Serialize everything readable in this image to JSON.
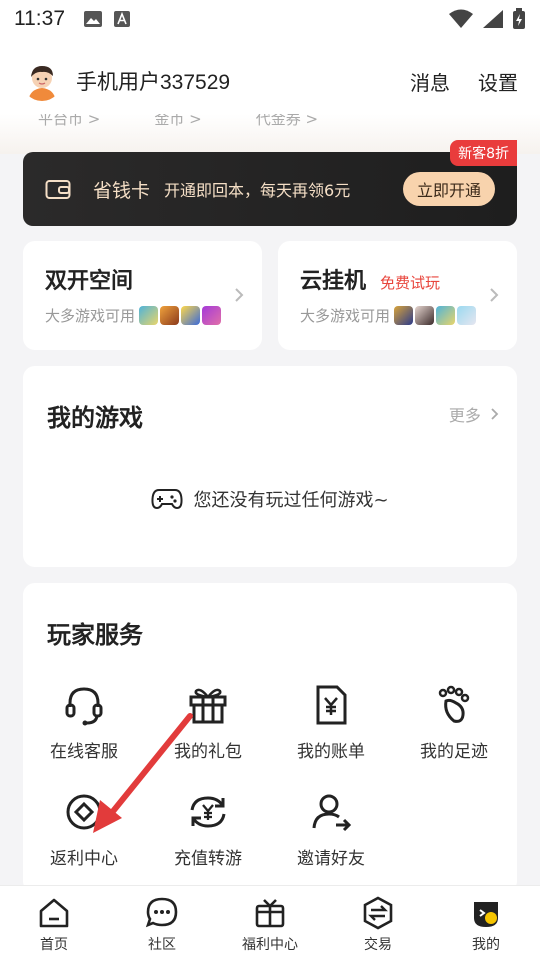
{
  "status_bar": {
    "time": "11:37"
  },
  "header": {
    "username": "手机用户337529",
    "actions": [
      "消息",
      "设置"
    ]
  },
  "cut_row": [
    "平台币 >",
    "金币 >",
    "代金券 >"
  ],
  "vip_card": {
    "title": "省钱卡",
    "description": "开通即回本，每天再领6元",
    "button": "立即开通",
    "badge": "新客8折"
  },
  "dual_space": {
    "title": "双开空间",
    "sub": "大多游戏可用"
  },
  "cloud_hangup": {
    "title": "云挂机",
    "badge": "免费试玩",
    "sub": "大多游戏可用"
  },
  "my_games": {
    "title": "我的游戏",
    "more": "更多",
    "empty_text": "您还没有玩过任何游戏~"
  },
  "services": {
    "title": "玩家服务",
    "items": [
      {
        "label": "在线客服",
        "icon": "headset-icon"
      },
      {
        "label": "我的礼包",
        "icon": "gift-icon"
      },
      {
        "label": "我的账单",
        "icon": "bill-icon"
      },
      {
        "label": "我的足迹",
        "icon": "footprint-icon"
      },
      {
        "label": "返利中心",
        "icon": "rebate-icon"
      },
      {
        "label": "充值转游",
        "icon": "recharge-transfer-icon"
      },
      {
        "label": "邀请好友",
        "icon": "invite-friend-icon"
      }
    ]
  },
  "tabbar": [
    {
      "label": "首页",
      "icon": "home-icon"
    },
    {
      "label": "社区",
      "icon": "community-icon"
    },
    {
      "label": "福利中心",
      "icon": "welfare-icon"
    },
    {
      "label": "交易",
      "icon": "trade-icon"
    },
    {
      "label": "我的",
      "icon": "mine-icon"
    }
  ],
  "colors": {
    "accent_red": "#e8453c",
    "vip_gold": "#f5dfc6",
    "vip_button": "#f8d3ad",
    "annotation_arrow": "#e23b3b"
  }
}
